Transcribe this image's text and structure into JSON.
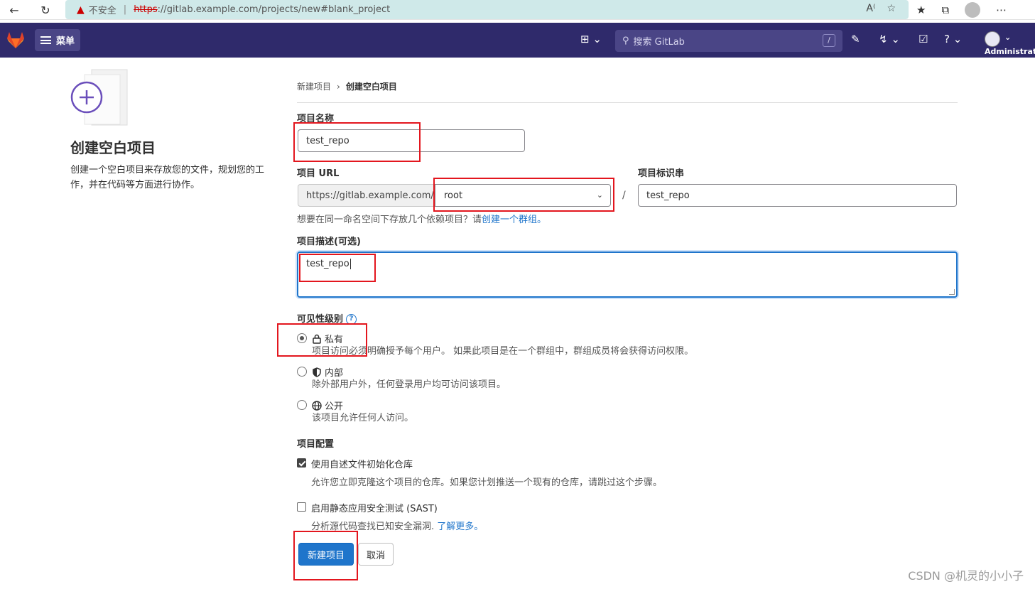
{
  "browser": {
    "insecure_label": "不安全",
    "url_scheme": "https",
    "url_rest": "://gitlab.example.com/projects/new#blank_project"
  },
  "header": {
    "menu_label": "菜单",
    "search_placeholder": "搜索 GitLab",
    "search_shortcut": "/",
    "user_name": "Administrator"
  },
  "left": {
    "title": "创建空白项目",
    "description": "创建一个空白项目来存放您的文件，规划您的工作，并在代码等方面进行协作。"
  },
  "breadcrumb": {
    "parent": "新建项目",
    "current": "创建空白项目"
  },
  "form": {
    "name_label": "项目名称",
    "name_value": "test_repo",
    "url_label": "项目 URL",
    "url_prefix": "https://gitlab.example.com/",
    "namespace_value": "root",
    "slug_label": "项目标识串",
    "slug_value": "test_repo",
    "help_text": "想要在同一命名空间下存放几个依赖项目？请",
    "help_link": "创建一个群组。",
    "desc_label": "项目描述(可选)",
    "desc_value": "test_repo",
    "visibility_label": "可见性级别",
    "visibility": [
      {
        "title": "私有",
        "desc": "项目访问必须明确授予每个用户。 如果此项目是在一个群组中，群组成员将会获得访问权限。",
        "icon": "lock-icon",
        "selected": true
      },
      {
        "title": "内部",
        "desc": "除外部用户外，任何登录用户均可访问该项目。",
        "icon": "shield-icon",
        "selected": false
      },
      {
        "title": "公开",
        "desc": "该项目允许任何人访问。",
        "icon": "globe-icon",
        "selected": false
      }
    ],
    "config_label": "项目配置",
    "readme_label": "使用自述文件初始化仓库",
    "readme_checked": true,
    "readme_desc": "允许您立即克隆这个项目的仓库。如果您计划推送一个现有的仓库，请跳过这个步骤。",
    "sast_label": "启用静态应用安全测试 (SAST)",
    "sast_checked": false,
    "sast_desc": "分析源代码查找已知安全漏洞.",
    "sast_link": "了解更多。",
    "create_button": "新建项目",
    "cancel_button": "取消"
  },
  "watermark": "CSDN @机灵的小小子",
  "colors": {
    "header_bg": "#2f2a6b",
    "primary": "#1f75cb",
    "annotation": "#e3161e"
  }
}
